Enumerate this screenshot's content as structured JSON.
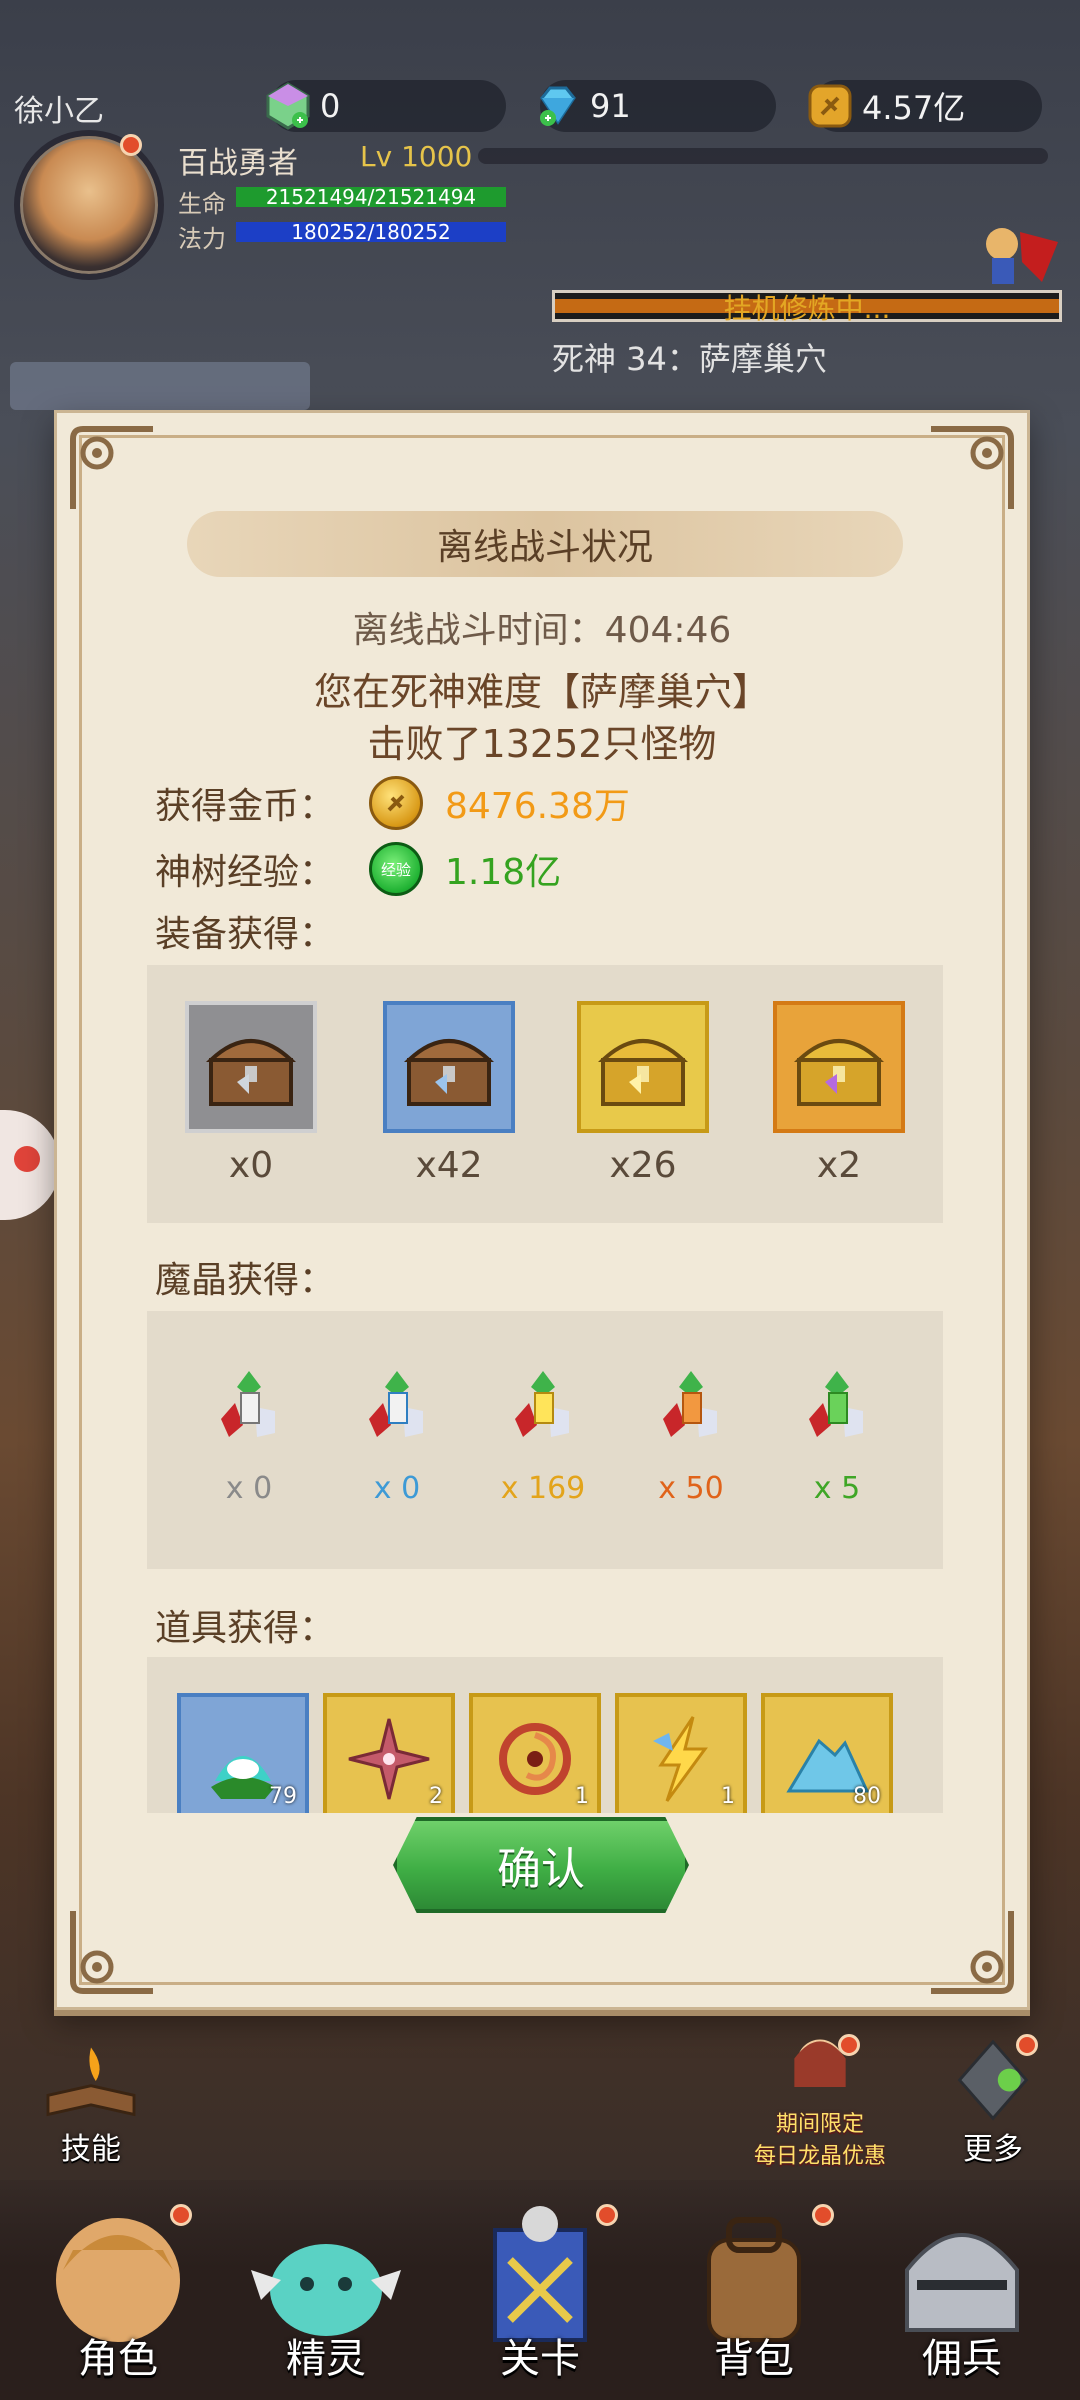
{
  "player": {
    "name": "徐小乙",
    "title": "百战勇者",
    "level": "Lv 1000",
    "hp_label": "生命",
    "hp_value": "21521494/21521494",
    "mp_label": "法力",
    "mp_value": "180252/180252"
  },
  "resources": {
    "crystal": "0",
    "diamond": "91",
    "gold": "4.57亿"
  },
  "stage": {
    "status": "挂机修炼中...",
    "name": "死神 34：萨摩巢穴"
  },
  "dialog": {
    "title": "离线战斗状况",
    "time_line": "离线战斗时间：404:46",
    "defeat_line1": "您在死神难度【萨摩巢穴】",
    "defeat_line2": "击败了13252只怪物",
    "gold_label": "获得金币：",
    "gold_value": "8476.38万",
    "exp_label": "神树经验：",
    "exp_icon_text": "经验",
    "exp_value": "1.18亿",
    "equip_label": "装备获得：",
    "equip_counts": [
      "x0",
      "x42",
      "x26",
      "x2"
    ],
    "crystal_label": "魔晶获得：",
    "crystal_counts": [
      "x 0",
      "x 0",
      "x 169",
      "x 50",
      "x 5"
    ],
    "crystal_colors": [
      "#8a8a8a",
      "#3d9ad6",
      "#e3a41b",
      "#e0631a",
      "#3fa626"
    ],
    "item_label": "道具获得：",
    "item_qty": [
      "79",
      "2",
      "1",
      "1",
      "80"
    ],
    "confirm": "确认"
  },
  "bottom": {
    "skill": "技能",
    "promo_line1": "期间限定",
    "promo_line2": "每日龙晶优惠",
    "more": "更多",
    "nav": [
      "角色",
      "精灵",
      "关卡",
      "背包",
      "佣兵"
    ]
  }
}
